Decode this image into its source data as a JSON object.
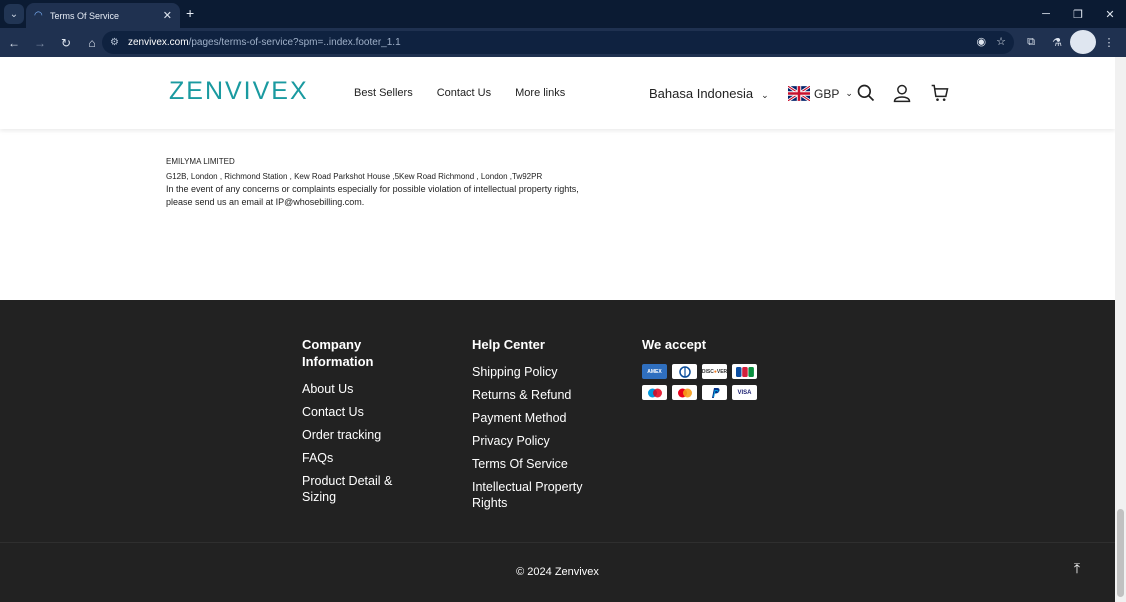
{
  "browser": {
    "tab_title": "Terms Of Service",
    "url_host": "zenvivex.com",
    "url_path": "/pages/terms-of-service?spm=..index.footer_1.1"
  },
  "header": {
    "logo": "ZENVIVEX",
    "menu": [
      "Best Sellers",
      "Contact Us",
      "More links"
    ],
    "language": "Bahasa Indonesia",
    "currency": "GBP"
  },
  "address": {
    "company": "EMILYMA LIMITED",
    "line": "G12B, London , Richmond Station , Kew Road Parkshot House ,5Kew Road Richmond , London ,Tw92PR",
    "notice": "In the event of any concerns or complaints especially for possible violation of intellectual property rights, please send us an email at IP@whosebilling.com."
  },
  "footer": {
    "company_title": "Company Information",
    "company_links": [
      "About Us",
      "Contact Us",
      "Order tracking",
      "FAQs",
      "Product Detail & Sizing"
    ],
    "help_title": "Help Center",
    "help_links": [
      "Shipping Policy",
      "Returns & Refund",
      "Payment Method",
      "Privacy Policy",
      "Terms Of Service",
      "Intellectual Property Rights"
    ],
    "accept_title": "We accept",
    "cards": [
      "amex",
      "diners",
      "discover",
      "jcb",
      "maestro",
      "mastercard",
      "paypal",
      "visa"
    ],
    "copyright": "© 2024 Zenvivex"
  },
  "colors": {
    "brand": "#1a9aa0",
    "footer_bg": "#222222"
  }
}
